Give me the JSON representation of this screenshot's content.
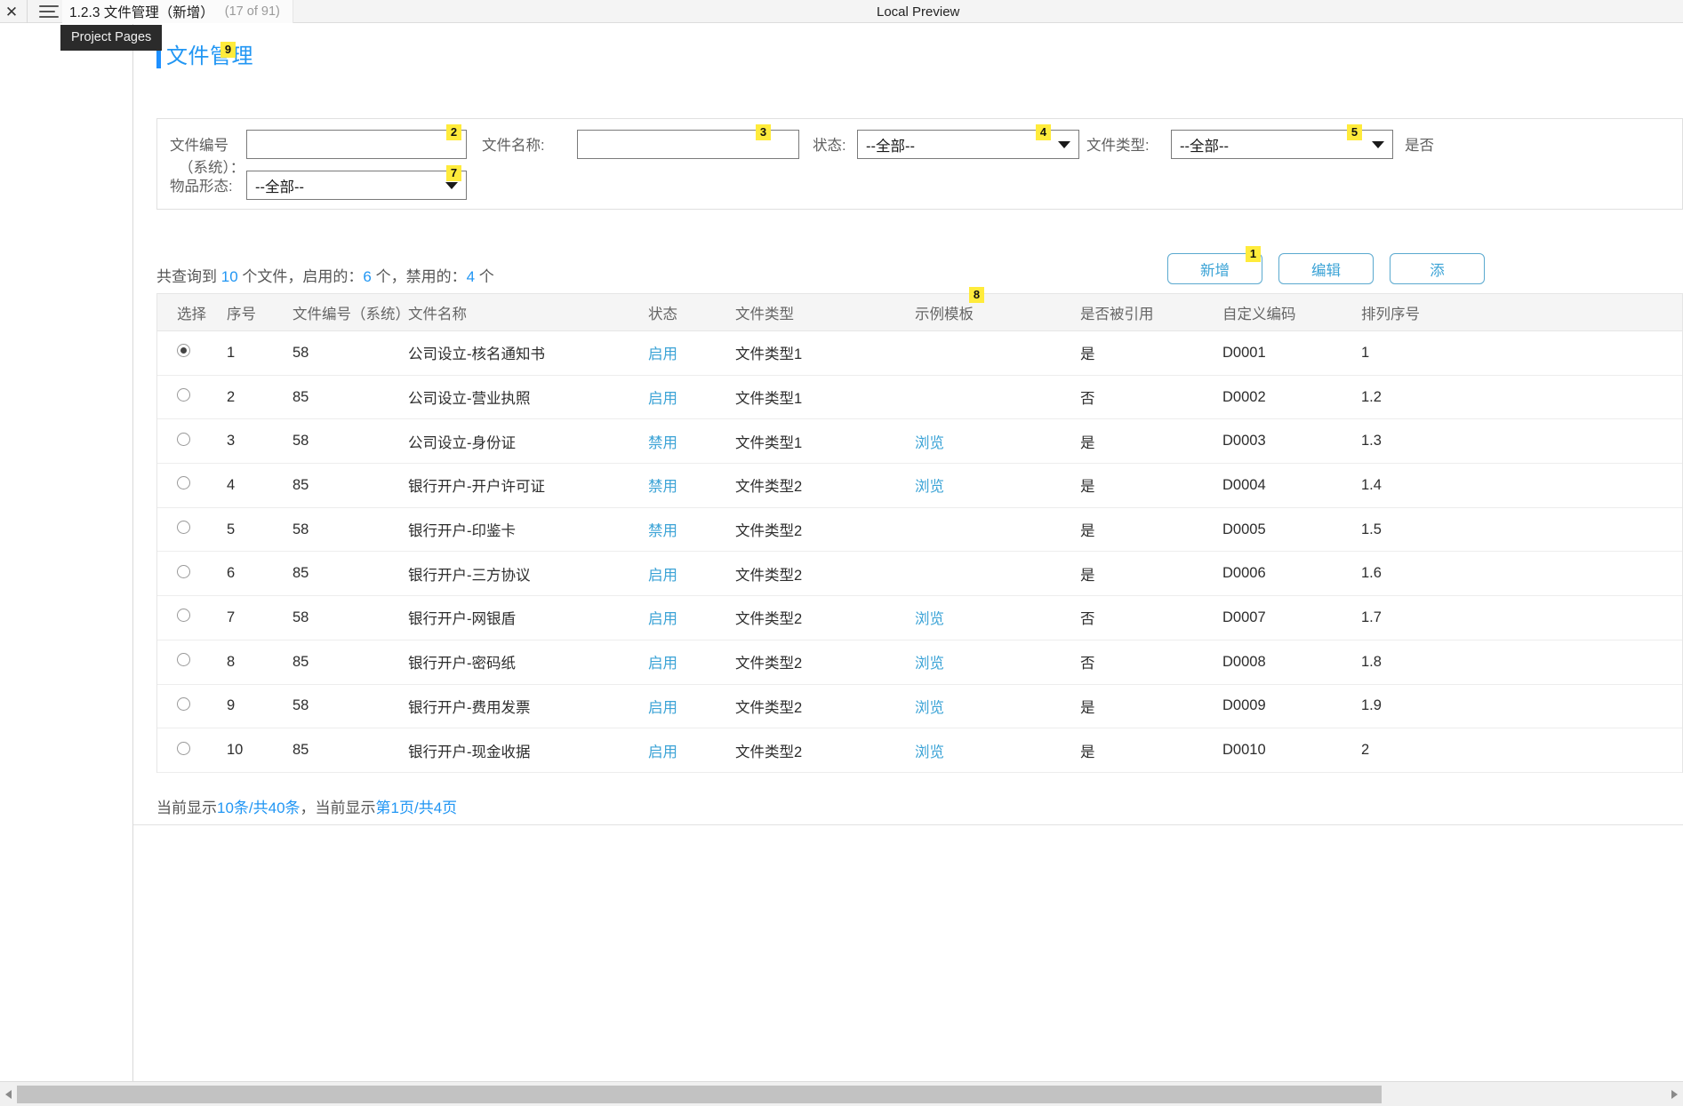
{
  "topbar": {
    "close_icon": "close-icon",
    "menu_icon": "hamburger-icon",
    "tab_title": "1.2.3 文件管理（新增）",
    "tab_count": "(17 of 91)",
    "local_preview": "Local Preview"
  },
  "tooltip": {
    "text": "Project Pages"
  },
  "page": {
    "title": "文件管理",
    "title_badge": "9"
  },
  "filters": {
    "file_code_label_line1": "文件编号",
    "file_code_label_line2": "（系统）：",
    "file_code_value": "",
    "file_code_badge": "2",
    "file_name_label": "文件名称:",
    "file_name_value": "",
    "file_name_badge": "3",
    "status_label": "状态:",
    "status_value": "--全部--",
    "status_badge": "4",
    "file_type_label": "文件类型:",
    "file_type_value": "--全部--",
    "file_type_badge": "5",
    "referenced_label": "是否",
    "item_form_label": "物品形态:",
    "item_form_value": "--全部--",
    "item_form_badge": "7"
  },
  "summary": {
    "prefix": "共查询到 ",
    "total": "10",
    "mid1": " 个文件，启用的：",
    "enabled": "6",
    "mid2": " 个，禁用的：",
    "disabled": "4",
    "suffix": " 个"
  },
  "toolbar": {
    "add_label": "新增",
    "add_badge": "1",
    "edit_label": "编辑",
    "third_label": "添"
  },
  "table": {
    "columns": [
      "选择",
      "序号",
      "文件编号（系统）",
      "文件名称",
      "状态",
      "文件类型",
      "示例模板",
      "是否被引用",
      "自定义编码",
      "排列序号"
    ],
    "template_badge": "8",
    "rows": [
      {
        "selected": true,
        "seq": "1",
        "code": "58",
        "name": "公司设立-核名通知书",
        "state": "启用",
        "type": "文件类型1",
        "template": "",
        "referenced": "是",
        "custom": "D0001",
        "order": "1"
      },
      {
        "selected": false,
        "seq": "2",
        "code": "85",
        "name": "公司设立-营业执照",
        "state": "启用",
        "type": "文件类型1",
        "template": "",
        "referenced": "否",
        "custom": "D0002",
        "order": "1.2"
      },
      {
        "selected": false,
        "seq": "3",
        "code": "58",
        "name": "公司设立-身份证",
        "state": "禁用",
        "type": "文件类型1",
        "template": "浏览",
        "referenced": "是",
        "custom": "D0003",
        "order": "1.3"
      },
      {
        "selected": false,
        "seq": "4",
        "code": "85",
        "name": "银行开户-开户许可证",
        "state": "禁用",
        "type": "文件类型2",
        "template": "浏览",
        "referenced": "是",
        "custom": "D0004",
        "order": "1.4"
      },
      {
        "selected": false,
        "seq": "5",
        "code": "58",
        "name": "银行开户-印鉴卡",
        "state": "禁用",
        "type": "文件类型2",
        "template": "",
        "referenced": "是",
        "custom": "D0005",
        "order": "1.5"
      },
      {
        "selected": false,
        "seq": "6",
        "code": "85",
        "name": "银行开户-三方协议",
        "state": "启用",
        "type": "文件类型2",
        "template": "",
        "referenced": "是",
        "custom": "D0006",
        "order": "1.6"
      },
      {
        "selected": false,
        "seq": "7",
        "code": "58",
        "name": "银行开户-网银盾",
        "state": "启用",
        "type": "文件类型2",
        "template": "浏览",
        "referenced": "否",
        "custom": "D0007",
        "order": "1.7"
      },
      {
        "selected": false,
        "seq": "8",
        "code": "85",
        "name": "银行开户-密码纸",
        "state": "启用",
        "type": "文件类型2",
        "template": "浏览",
        "referenced": "否",
        "custom": "D0008",
        "order": "1.8"
      },
      {
        "selected": false,
        "seq": "9",
        "code": "58",
        "name": "银行开户-费用发票",
        "state": "启用",
        "type": "文件类型2",
        "template": "浏览",
        "referenced": "是",
        "custom": "D0009",
        "order": "1.9"
      },
      {
        "selected": false,
        "seq": "10",
        "code": "85",
        "name": "银行开户-现金收据",
        "state": "启用",
        "type": "文件类型2",
        "template": "浏览",
        "referenced": "是",
        "custom": "D0010",
        "order": "2"
      }
    ]
  },
  "pager": {
    "p1": "当前显示",
    "shown": "10条/共40条",
    "p2": "，当前显示",
    "page": "第1页/共4页"
  },
  "colors": {
    "accent": "#2196f3",
    "link": "#3ba3d6",
    "badge_bg": "#ffeb3b"
  }
}
